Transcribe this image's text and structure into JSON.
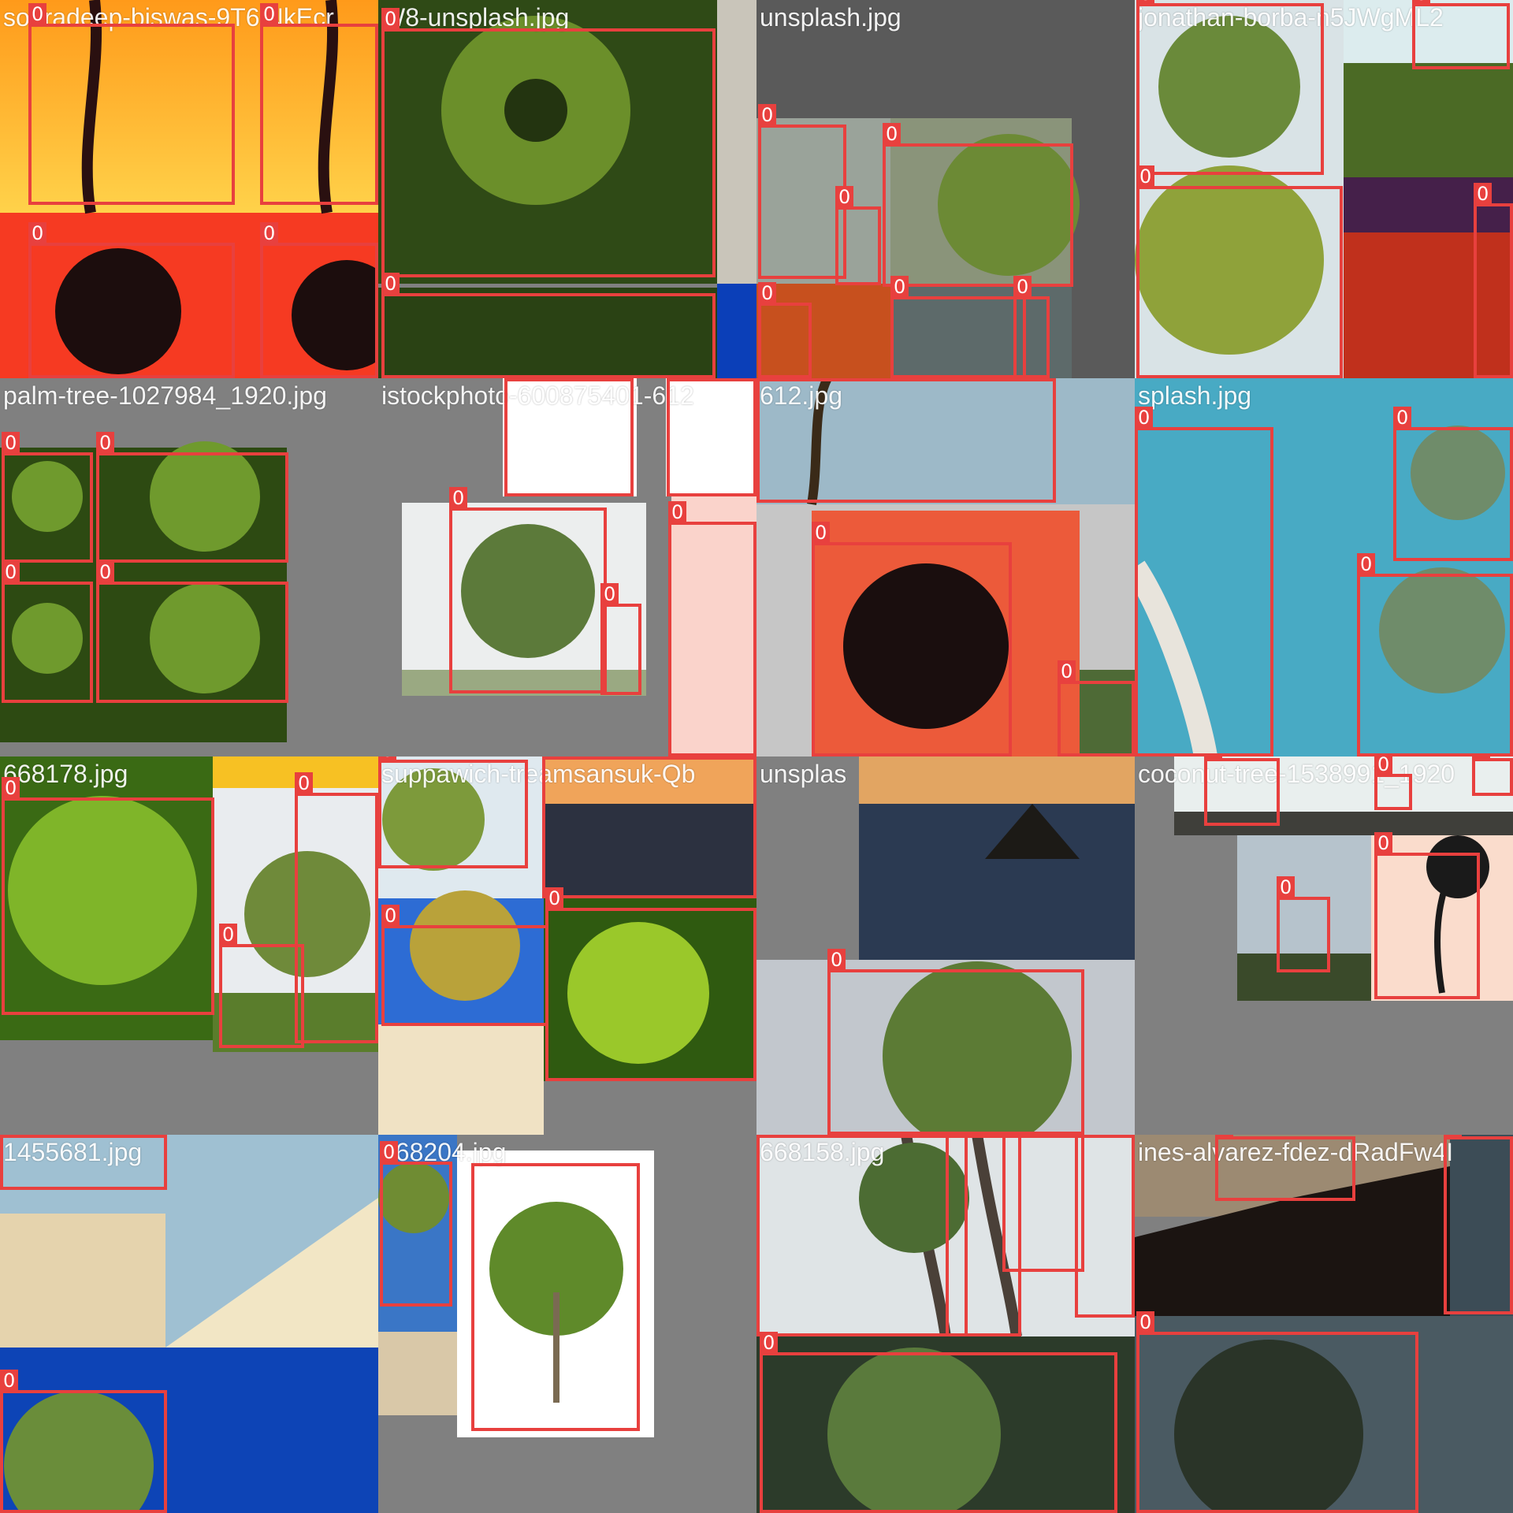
{
  "mosaic": {
    "tiles": [
      {
        "name": "souradeep-biswas-9T6iNkEcr",
        "class_label": "0"
      },
      {
        "name": "W8-unsplash.jpg",
        "class_label": "0"
      },
      {
        "name": "unsplash.jpg",
        "class_label": "0"
      },
      {
        "name": "jonathan-borba-n5JWgML2",
        "class_label": "0"
      },
      {
        "name": "palm-tree-1027984_1920.jpg",
        "class_label": "0"
      },
      {
        "name": "istockphoto-600875401-612",
        "class_label": "0"
      },
      {
        "name": "612.jpg",
        "class_label": "0"
      },
      {
        "name": "splash.jpg",
        "class_label": "0"
      },
      {
        "name": "668178.jpg",
        "class_label": "0"
      },
      {
        "name": "suppawich-treamsansuk-Qb",
        "class_label": "0"
      },
      {
        "name": "unsplas",
        "class_label": "0"
      },
      {
        "name": "coconut-tree-1538991_1920",
        "class_label": "0"
      },
      {
        "name": "1455681.jpg",
        "class_label": "0"
      },
      {
        "name": "668204.jpg",
        "class_label": "0"
      },
      {
        "name": "668158.jpg",
        "class_label": "0"
      },
      {
        "name": "ines-alvarez-fdez-dRadFw4I",
        "class_label": "0"
      }
    ]
  },
  "colors": {
    "box": "#e8403e",
    "background": "#7f7f7f",
    "label_text": "#ffffff"
  }
}
